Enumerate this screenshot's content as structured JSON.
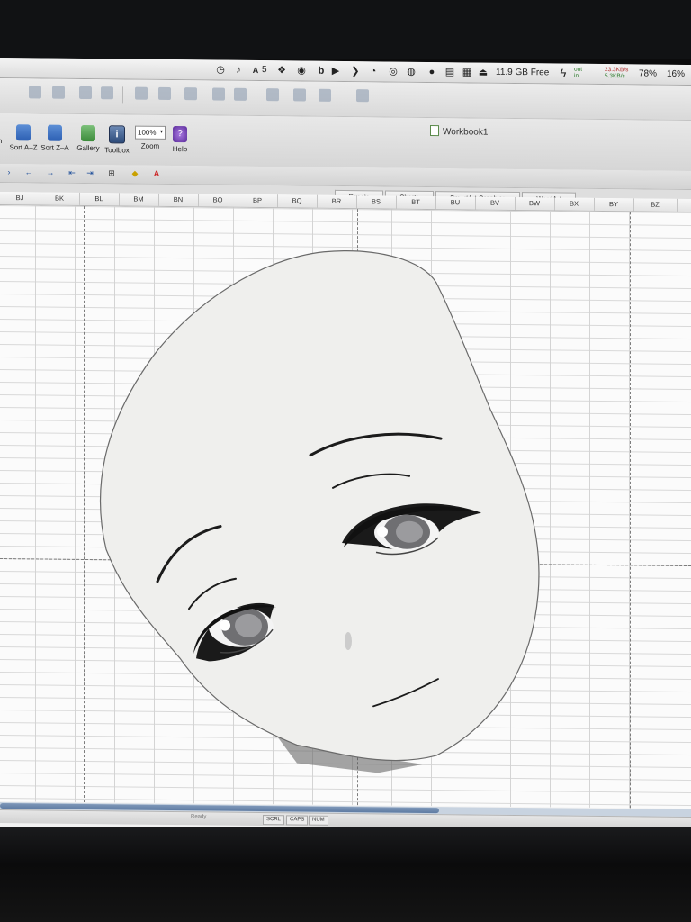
{
  "menubar": {
    "status_icons": [
      "check-circle-icon",
      "mic-icon",
      "adobe-icon",
      "dropbox-icon",
      "cloud-app-icon",
      "b-icon",
      "play-icon",
      "arrow-icon",
      "timer-icon",
      "evernote-icon",
      "pin-icon",
      "clipboard-icon",
      "drive-icon"
    ],
    "adobe_count": "5",
    "disk_free": "11.9 GB Free",
    "net_labels": {
      "out": "out",
      "in": "in"
    },
    "net_rates": {
      "out": "23.3KB/s",
      "in": "5.3KB/s"
    },
    "battery": "78%",
    "cpu": "16%"
  },
  "window": {
    "title": "Workbook1"
  },
  "ribbon": {
    "buttons": [
      {
        "label": "Sort A–Z"
      },
      {
        "label": "Sort Z–A"
      },
      {
        "label": "Gallery"
      },
      {
        "label": "Toolbox"
      },
      {
        "label": "Zoom"
      },
      {
        "label": "Help"
      }
    ],
    "sort_prefix": "n",
    "zoom_value": "100%",
    "help_glyph": "?"
  },
  "gallery_tabs": [
    "Sheets",
    "Charts",
    "SmartArt Graphics",
    "WordArt"
  ],
  "columns": [
    "BJ",
    "BK",
    "BL",
    "BM",
    "BN",
    "BO",
    "BP",
    "BQ",
    "BR",
    "BS",
    "BT",
    "BU",
    "BV",
    "BW",
    "BX",
    "BY",
    "BZ"
  ],
  "statusbar": {
    "mode": "Ready",
    "indicators": [
      "SCRL",
      "CAPS",
      "NUM"
    ]
  },
  "colors": {
    "accent": "#2c5fb3",
    "grid_line": "#d3d3d3",
    "shape_fill": "#f0f0ef",
    "eye_iris": "#6f6f72"
  }
}
